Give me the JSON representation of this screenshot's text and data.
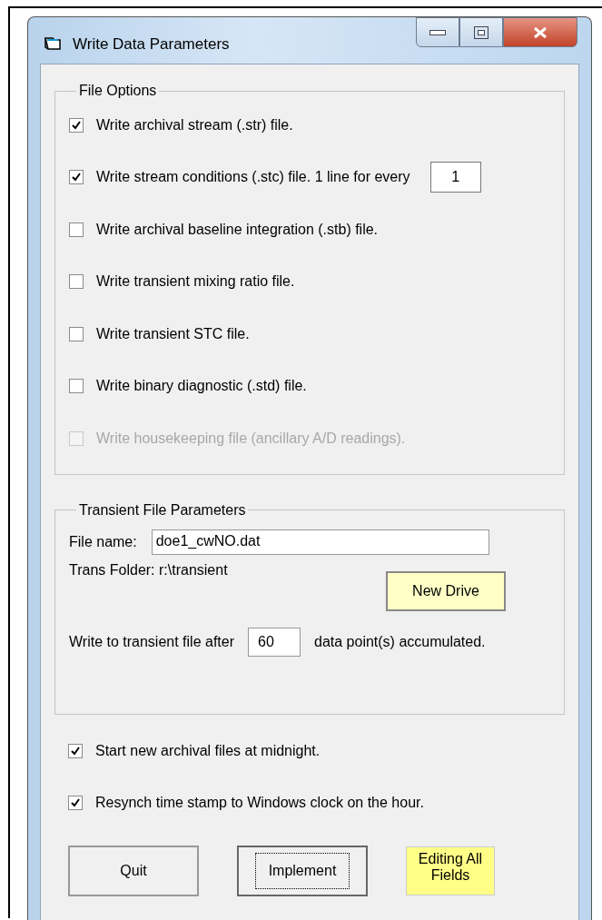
{
  "window": {
    "title": "Write Data Parameters"
  },
  "file_options": {
    "title": "File Options",
    "options": [
      {
        "kind": "checkbox",
        "label": "Write archival stream (.str) file.",
        "checked": true,
        "disabled": false
      },
      {
        "kind": "checkbox-count",
        "label": "Write stream conditions (.stc) file. 1 line for every",
        "checked": true,
        "disabled": false,
        "value": "1"
      },
      {
        "kind": "checkbox",
        "label": "Write archival baseline integration (.stb) file.",
        "checked": false,
        "disabled": false
      },
      {
        "kind": "checkbox",
        "label": "Write transient mixing ratio file.",
        "checked": false,
        "disabled": false
      },
      {
        "kind": "checkbox",
        "label": "Write transient STC file.",
        "checked": false,
        "disabled": false
      },
      {
        "kind": "checkbox",
        "label": "Write binary diagnostic (.std) file.",
        "checked": false,
        "disabled": false
      },
      {
        "kind": "checkbox",
        "label": "Write housekeeping file (ancillary A/D readings).",
        "checked": false,
        "disabled": true
      }
    ]
  },
  "transient": {
    "title": "Transient File Parameters",
    "file_name_label": "File name:",
    "file_name": "doe1_cwNO.dat",
    "folder": "Trans Folder: r:\\transient",
    "new_drive_button": "New Drive",
    "write_after_label": "Write to transient file after",
    "write_after_value": "60",
    "write_after_suffix": "data point(s) accumulated."
  },
  "options": [
    {
      "label": "Start new archival files at midnight.",
      "checked": true
    },
    {
      "label": "Resynch time stamp to Windows clock on the hour.",
      "checked": true
    }
  ],
  "buttons": [
    {
      "label": "Quit",
      "focused": false
    },
    {
      "label": "Implement",
      "focused": true
    }
  ],
  "status": "Editing All Fields"
}
